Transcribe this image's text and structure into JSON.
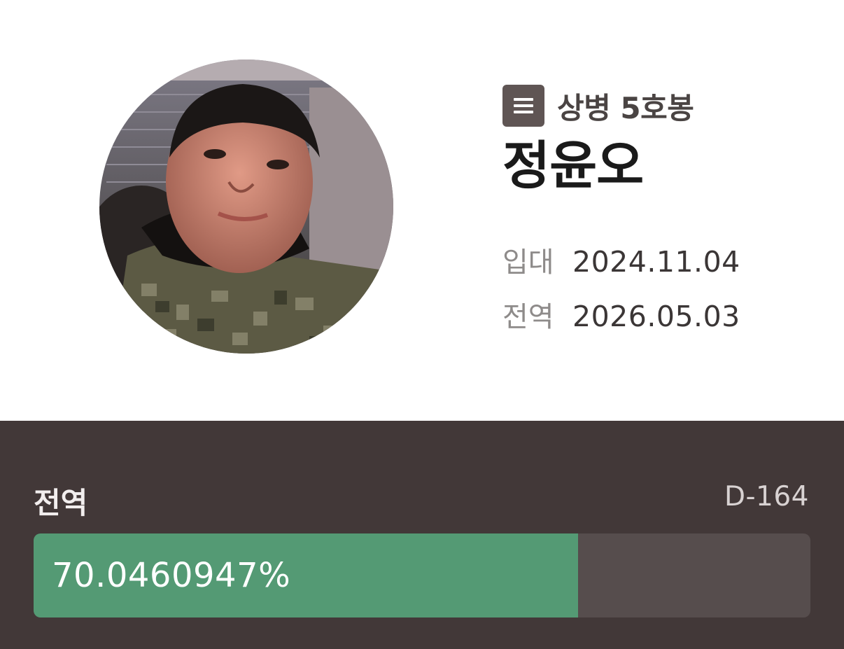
{
  "profile": {
    "rank": "상병 5호봉",
    "rank_icon": "menu-lines-icon",
    "name": "정윤오",
    "enlist_label": "입대",
    "enlist_date": "2024.11.04",
    "discharge_label": "전역",
    "discharge_date": "2026.05.03"
  },
  "progress": {
    "title": "전역",
    "dday": "D-164",
    "percent_text": "70.0460947%",
    "fraction": 0.700460947
  },
  "colors": {
    "panel_bg": "#423838",
    "track_bg": "#564d4d",
    "fill": "#549a74",
    "rank_icon_bg": "#5f5554"
  }
}
